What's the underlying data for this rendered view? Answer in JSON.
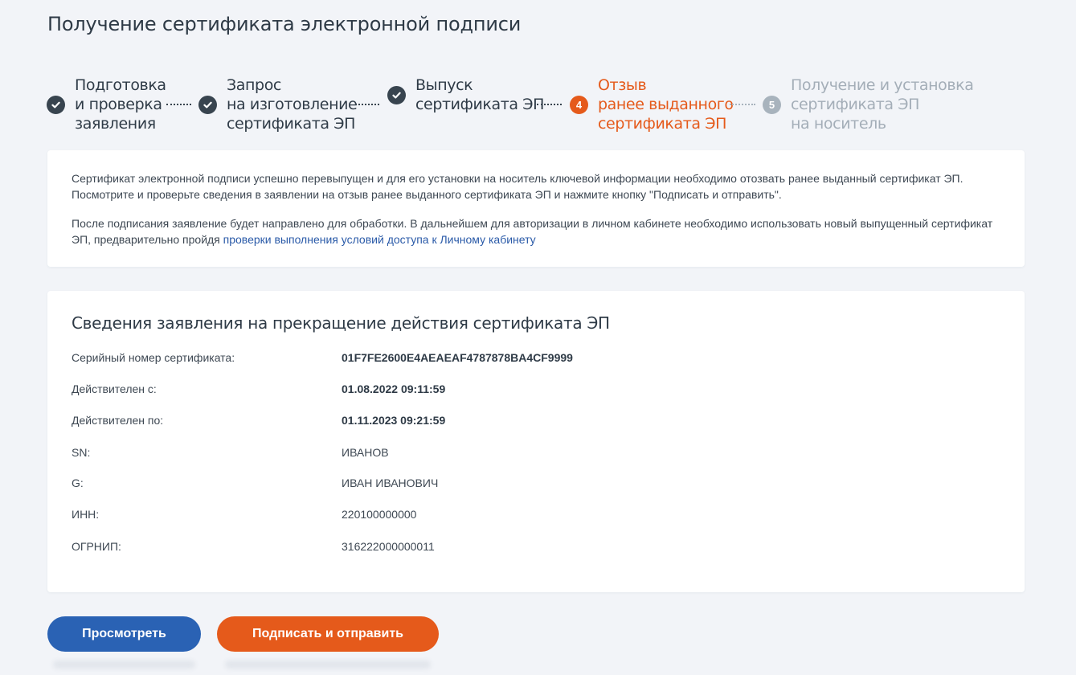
{
  "page": {
    "title": "Получение сертификата электронной подписи"
  },
  "steps": [
    {
      "number": "",
      "label": "Подготовка\nи проверка\nзаявления",
      "state": "done"
    },
    {
      "number": "",
      "label": "Запрос\nна изготовление\nсертификата ЭП",
      "state": "done"
    },
    {
      "number": "",
      "label": "Выпуск\nсертификата ЭП",
      "state": "done"
    },
    {
      "number": "4",
      "label": "Отзыв\nранее выданного\nсертификата ЭП",
      "state": "active"
    },
    {
      "number": "5",
      "label": "Получение и установка\nсертификата ЭП\nна носитель",
      "state": "future"
    }
  ],
  "info": {
    "paragraph1": "Сертификат электронной подписи успешно перевыпущен и для его установки на носитель ключевой информации необходимо отозвать ранее выданный сертификат ЭП. Посмотрите и проверьте сведения в заявлении на отзыв ранее выданного сертификата ЭП и нажмите кнопку \"Подписать и отправить\".",
    "paragraph2_prefix": "После подписания заявление будет направлено для обработки. В дальнейшем для авторизации в личном кабинете необходимо использовать новый выпущенный сертификат ЭП, предварительно пройдя ",
    "link_text": "проверки выполнения условий доступа к Личному кабинету"
  },
  "details": {
    "title": "Сведения заявления на прекращение действия сертификата ЭП",
    "rows": [
      {
        "label": "Серийный номер сертификата:",
        "value": "01F7FE2600E4AEAEAF4787878BA4CF9999",
        "bold": true
      },
      {
        "label": "Действителен с:",
        "value": "01.08.2022 09:11:59",
        "bold": true
      },
      {
        "label": "Действителен по:",
        "value": "01.11.2023 09:21:59",
        "bold": true
      },
      {
        "label": "SN:",
        "value": "ИВАНОВ",
        "bold": false
      },
      {
        "label": "G:",
        "value": "ИВАН ИВАНОВИЧ",
        "bold": false
      },
      {
        "label": "ИНН:",
        "value": "220100000000",
        "bold": false
      },
      {
        "label": "ОГРНИП:",
        "value": "316222000000011",
        "bold": false
      }
    ]
  },
  "buttons": {
    "view": "Просмотреть",
    "sign": "Подписать и отправить"
  },
  "colors": {
    "accent": "#e55a1b",
    "primary": "#2a62b4",
    "done": "#38444f",
    "future": "#a8b3bd"
  }
}
